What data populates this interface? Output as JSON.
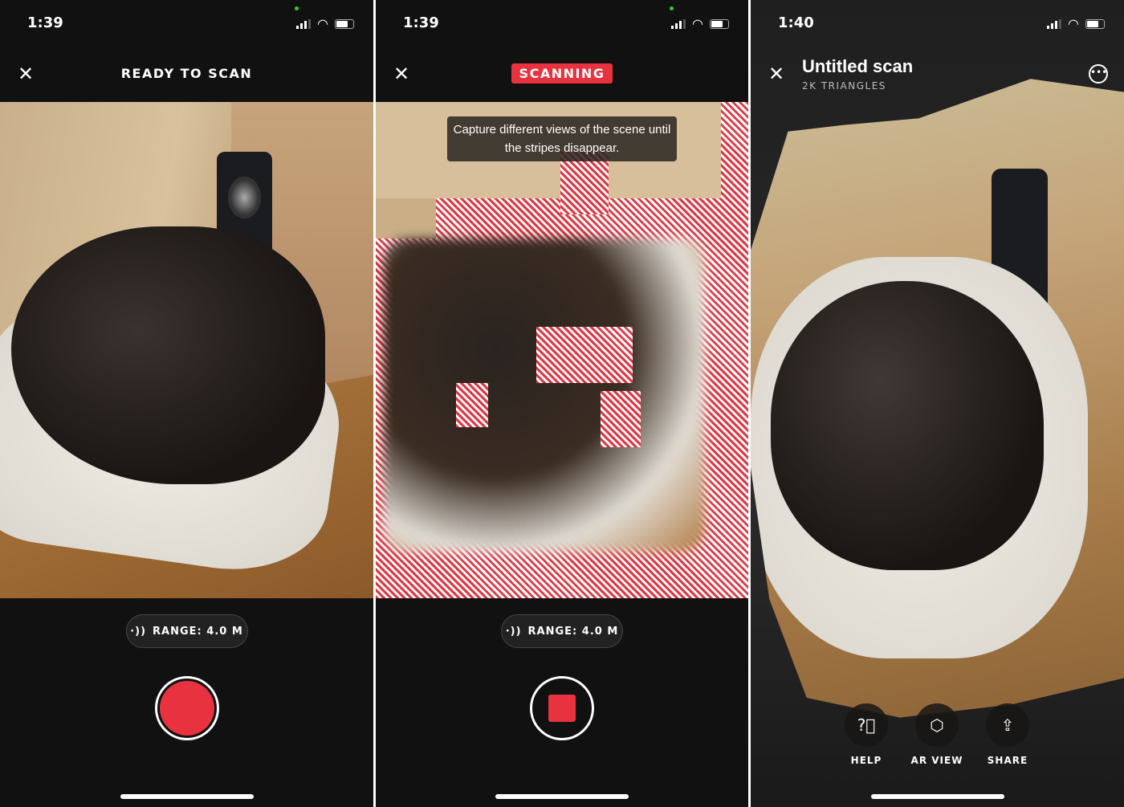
{
  "screens": [
    {
      "time": "1:39",
      "title": "READY TO SCAN",
      "range_label": "RANGE: 4.0 M",
      "record_state": "idle"
    },
    {
      "time": "1:39",
      "title": "SCANNING",
      "tip": "Capture different views of the scene until the stripes disappear.",
      "range_label": "RANGE: 4.0 M",
      "record_state": "recording"
    },
    {
      "time": "1:40",
      "title": "Untitled scan",
      "subtitle": "2K TRIANGLES",
      "actions": [
        {
          "label": "HELP",
          "icon": "help-icon"
        },
        {
          "label": "AR VIEW",
          "icon": "ar-view-icon"
        },
        {
          "label": "SHARE",
          "icon": "share-icon"
        }
      ]
    }
  ],
  "colors": {
    "accent": "#e8323f",
    "background": "#111111"
  }
}
